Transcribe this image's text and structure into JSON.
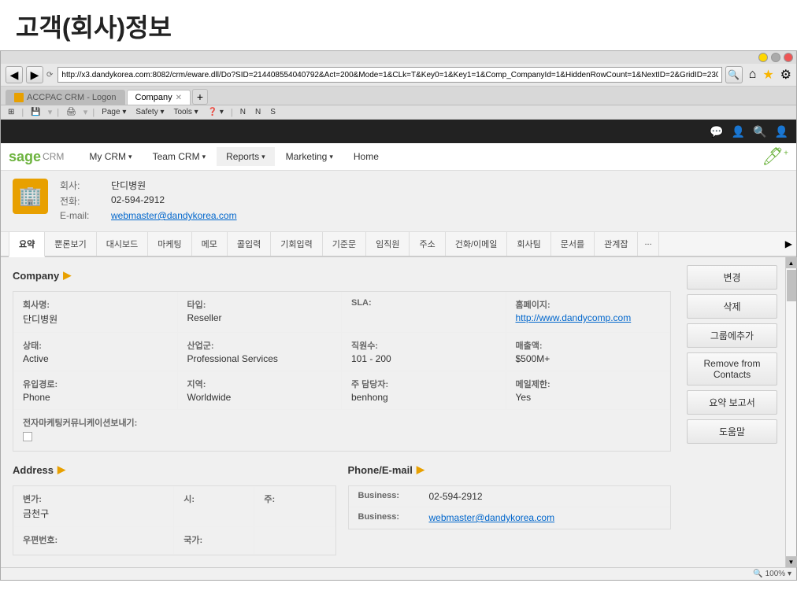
{
  "page": {
    "title": "고객(회사)정보"
  },
  "browser": {
    "address": "http://x3.dandykorea.com:8082/crm/eware.dll/Do?SID=214408554040792&Act=200&Mode=1&CLk=T&Key0=1&Key1=1&Comp_CompanyId=1&HiddenRowCount=1&NextID=2&GridID=230",
    "tab1_label": "ACCPAC CRM - Logon",
    "tab2_label": "Company"
  },
  "nav": {
    "my_crm": "My CRM",
    "team_crm": "Team CRM",
    "reports": "Reports",
    "marketing": "Marketing",
    "home": "Home",
    "add_icon": "🖊"
  },
  "company": {
    "name_label": "회사:",
    "name_value": "단디병원",
    "phone_label": "전화:",
    "phone_value": "02-594-2912",
    "email_label": "E-mail:",
    "email_value": "webmaster@dandykorea.com"
  },
  "sub_tabs": [
    "요약",
    "뿐론보기",
    "대시보드",
    "마케팅",
    "메모",
    "콜입력",
    "기회입력",
    "기준문",
    "임직원",
    "주소",
    "건화/이메일",
    "회사팀",
    "문서를",
    "관계잡",
    "..."
  ],
  "section": {
    "company_label": "Company",
    "fields": {
      "company_name_label": "회사명:",
      "company_name_value": "단디병원",
      "type_label": "타입:",
      "type_value": "Reseller",
      "sla_label": "SLA:",
      "sla_value": "",
      "website_label": "홈페이지:",
      "website_value": "http://www.dandycomp.com",
      "status_label": "상태:",
      "status_value": "Active",
      "industry_label": "산업군:",
      "industry_value": "Professional Services",
      "employees_label": "직원수:",
      "employees_value": "101 - 200",
      "revenue_label": "매출액:",
      "revenue_value": "$500M+",
      "source_label": "유입경로:",
      "source_value": "Phone",
      "territory_label": "지역:",
      "territory_value": "Worldwide",
      "contact_label": "주 담당자:",
      "contact_value": "benhong",
      "email_limit_label": "메일제한:",
      "email_limit_value": "Yes",
      "marketing_label": "전자마케팅커뮤니케이션보내기:"
    }
  },
  "address": {
    "label": "Address",
    "district_label": "변가:",
    "district_value": "금천구",
    "city_label": "시:",
    "city_value": "",
    "state_label": "주:",
    "state_value": "",
    "zip_label": "우편번호:",
    "zip_value": "",
    "country_label": "국가:",
    "country_value": ""
  },
  "phone_email": {
    "label": "Phone/E-mail",
    "business_label1": "Business:",
    "business_value1": "02-594-2912",
    "business_label2": "Business:",
    "business_value2": "webmaster@dandykorea.com"
  },
  "sidebar_buttons": {
    "edit": "변경",
    "delete": "삭제",
    "add_group": "그룹에추가",
    "remove_contacts": "Remove from Contacts",
    "summary_report": "요약 보고서",
    "help": "도움말"
  },
  "status_bar": {
    "zoom": "100%"
  }
}
